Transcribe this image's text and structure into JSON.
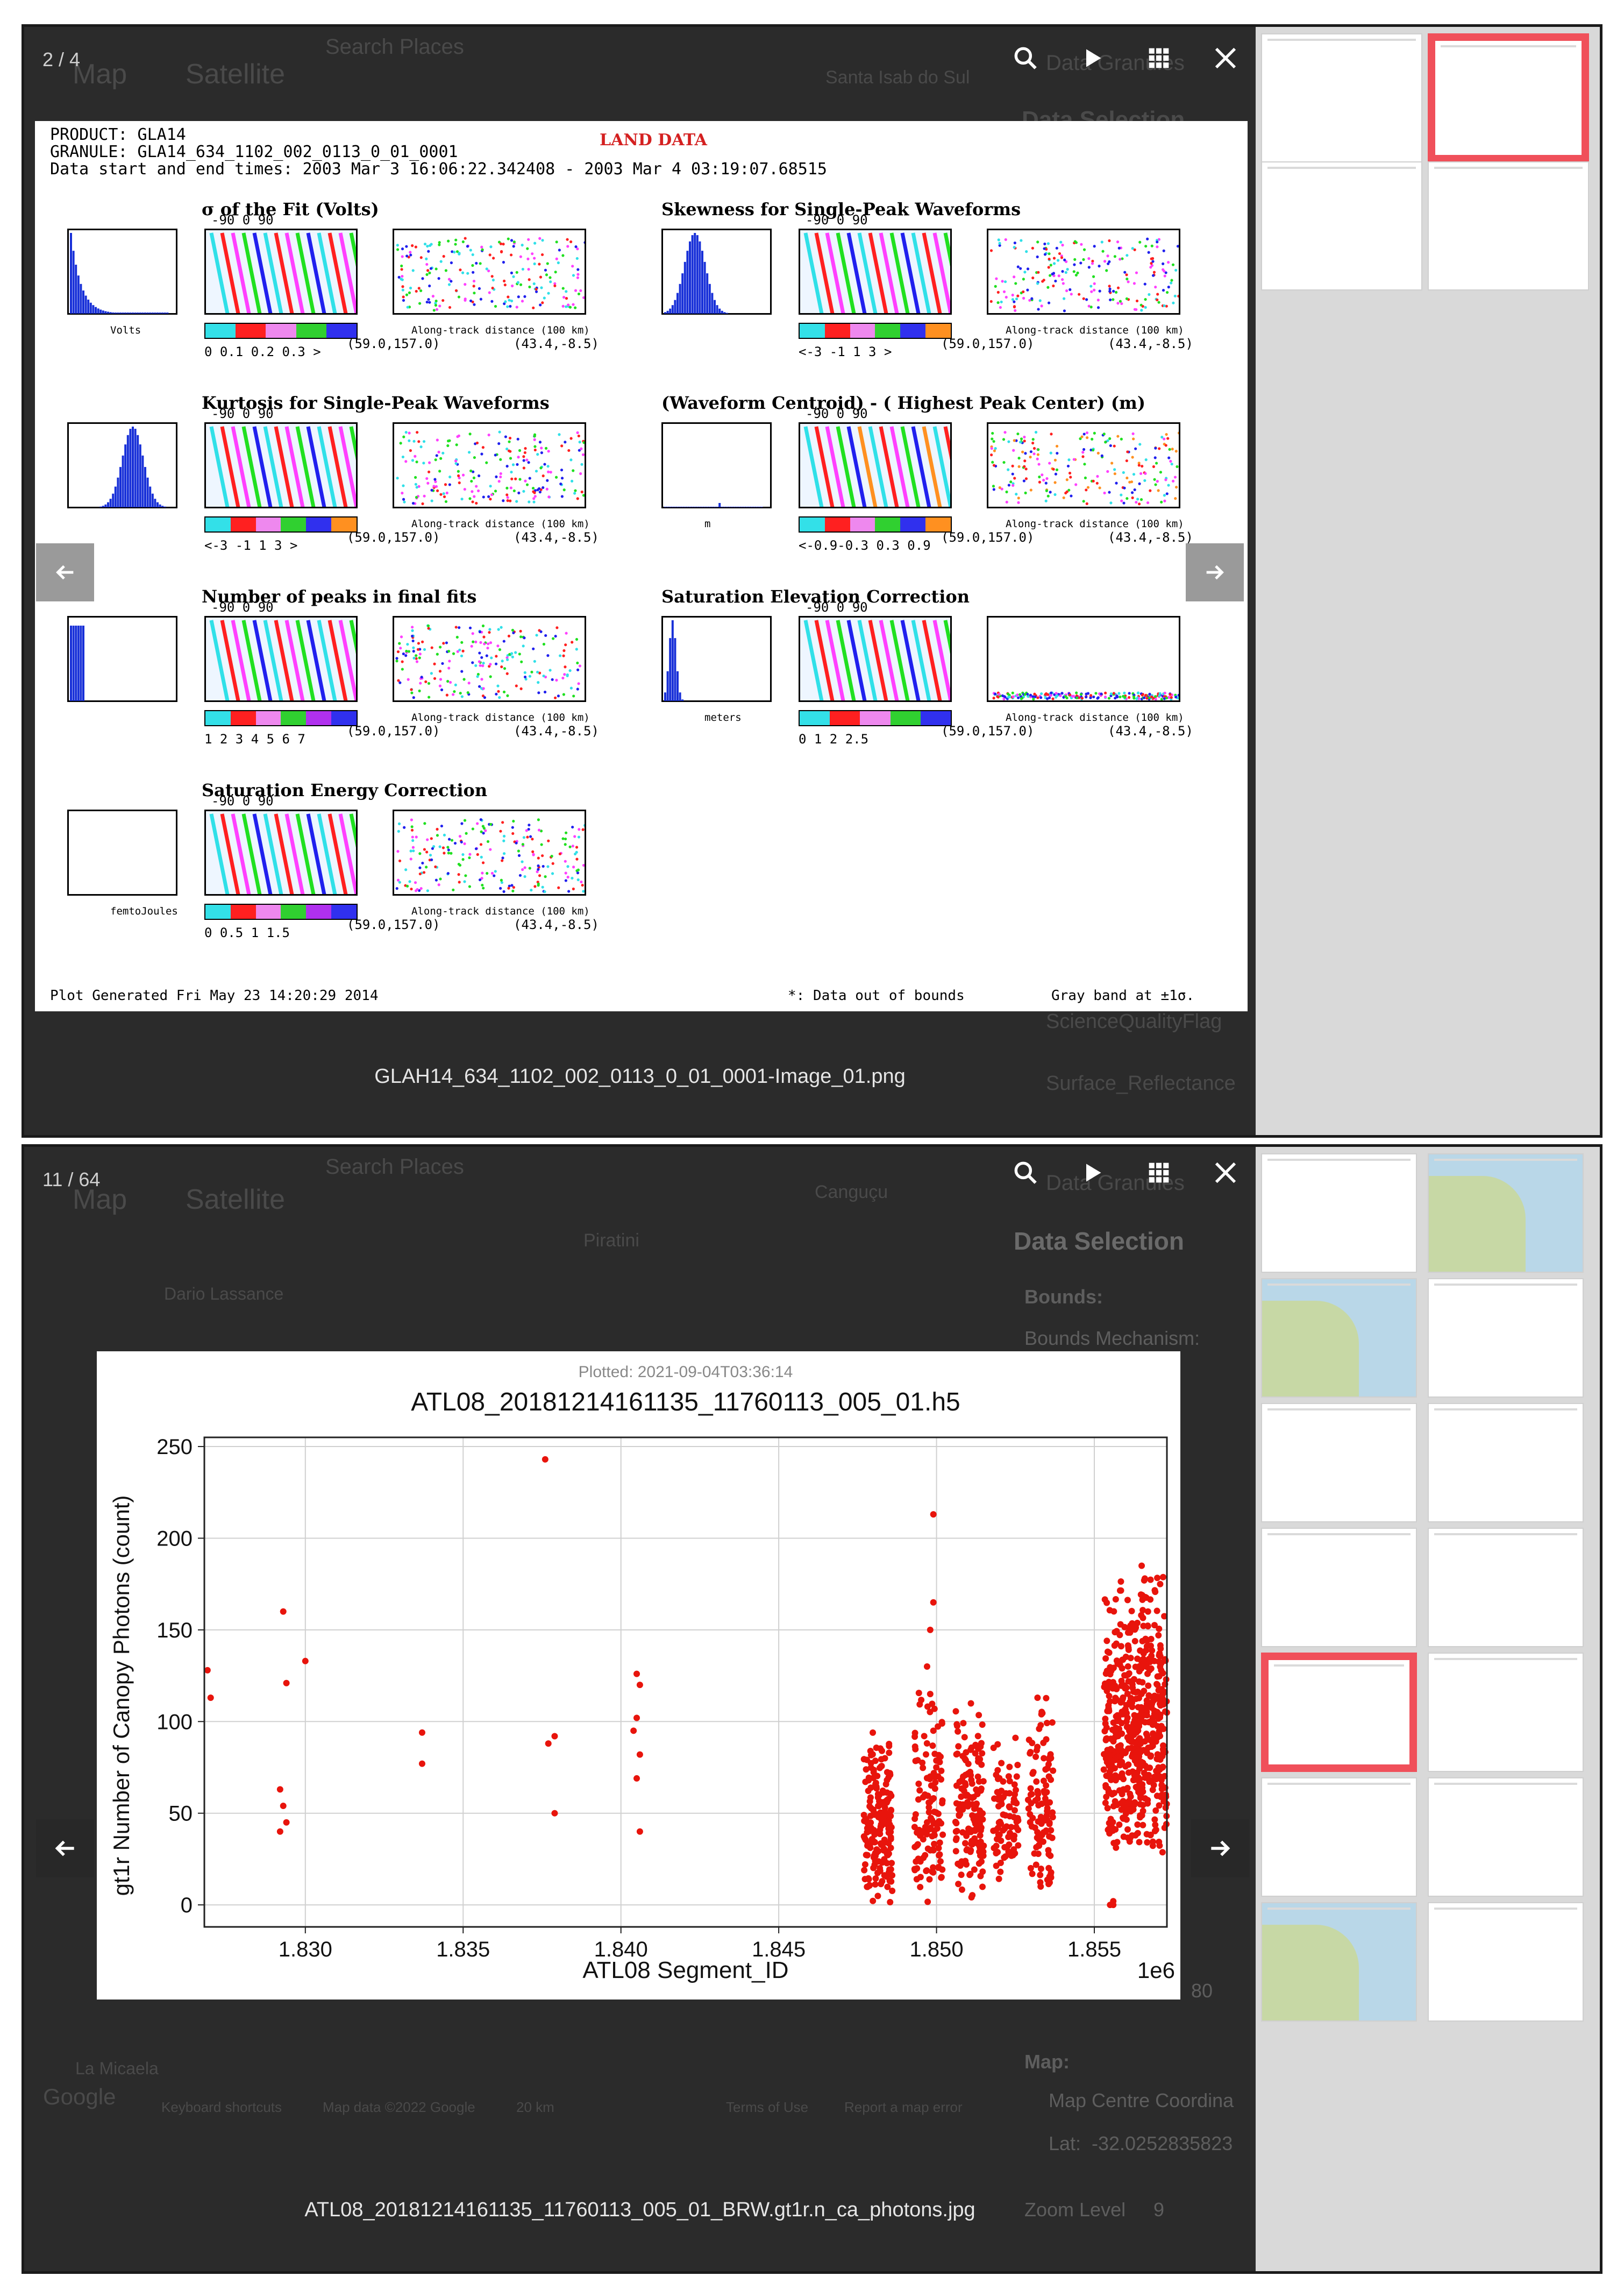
{
  "panel1": {
    "counter": "2 / 4",
    "map_tabs": [
      "Map",
      "Satellite"
    ],
    "search_placeholder": "Search Places",
    "caption": "GLAH14_634_1102_002_0113_0_01_0001-Image_01.png",
    "image": {
      "product": "PRODUCT: GLA14",
      "granule": "GRANULE: GLA14_634_1102_002_0113_0_01_0001",
      "dates": "Data start and end times: 2003 Mar 3 16:06:22.342408 - 2003 Mar 4 03:19:07.68515",
      "land_data": "LAND DATA",
      "titles": [
        "σ of the Fit (Volts)",
        "Skewness for Single-Peak Waveforms",
        "Kurtosis for Single-Peak Waveforms",
        "(Waveform Centroid) - ( Highest Peak Center) (m)",
        "Number of peaks in final fits",
        "Saturation Elevation Correction",
        "Saturation Energy Correction"
      ],
      "map_ticks": "-90 0 90",
      "along_track": "Along-track distance (100 km)",
      "coord_start": "(59.0,157.0)",
      "coord_end": "(43.4,-8.5)",
      "cbar_labels": [
        "0  0.1  0.2  0.3  >",
        "<-3   -1    1    3 >",
        "<-3   -1    1    3 >",
        "<-0.9-0.3 0.3 0.9",
        "1  2  3  4  5  6  7",
        "0       1       2  2.5",
        "0   0.5   1   1.5"
      ],
      "hist_xlabels": [
        "Volts",
        "",
        "",
        "m",
        "",
        "meters",
        "femtoJoules"
      ],
      "footer_left": "Plot Generated Fri May 23 14:20:29 2014",
      "footer_mid": "*: Data out of bounds",
      "footer_right": "Gray band at ±1σ."
    },
    "bg_labels": [
      "Data Granules",
      "Data Selection",
      "ScienceQualityFlag",
      "Surface_Reflectance",
      "Santa Isab do Sul"
    ]
  },
  "panel2": {
    "counter": "11 / 64",
    "map_tabs": [
      "Map",
      "Satellite"
    ],
    "search_placeholder": "Search Places",
    "caption": "ATL08_20181214161135_11760113_005_01_BRW.gt1r.n_ca_photons.jpg",
    "bg_labels": [
      "Data Granules",
      "Data Selection",
      "Bounds:",
      "Bounds Mechanism:",
      "Map:",
      "Map Centre Coordina",
      "Lat:",
      "-32.0252835823",
      "Zoom Level",
      "9",
      "Keyboard shortcuts",
      "Map data ©2022 Google",
      "20 km",
      "Terms of Use",
      "Report a map error",
      "Google",
      "Piratini",
      "Canguçu",
      "La Micaela",
      "Dario Lassance",
      "80"
    ]
  },
  "chart_data": {
    "type": "scatter",
    "subtitle": "Plotted: 2021-09-04T03:36:14",
    "title": "ATL08_20181214161135_11760113_005_01.h5",
    "xlabel": "ATL08 Segment_ID",
    "ylabel": "gt1r Number of Canopy Photons (count)",
    "x_offset_label": "1e6",
    "xlim": [
      1826800,
      1857300
    ],
    "ylim": [
      -12,
      255
    ],
    "xticks": [
      1.83,
      1.835,
      1.84,
      1.845,
      1.85,
      1.855
    ],
    "xtick_labels": [
      "1.830",
      "1.835",
      "1.840",
      "1.845",
      "1.850",
      "1.855"
    ],
    "yticks": [
      0,
      50,
      100,
      150,
      200,
      250
    ],
    "grid": true,
    "color": "#e8140c",
    "x": [
      1826900,
      1827000,
      1829300,
      1829400,
      1829200,
      1829300,
      1829400,
      1829200,
      1830000,
      1833700,
      1833700,
      1837600,
      1837900,
      1837700,
      1837900,
      1840500,
      1840600,
      1840500,
      1840400,
      1840600,
      1840500,
      1840600,
      1849900,
      1849900,
      1849800,
      1849700,
      1849800,
      1849900,
      1849800,
      1849700,
      1853200,
      1853300,
      1853400,
      1853200,
      1853300,
      1853100,
      1853300,
      1855500,
      1855600,
      1855600,
      1856500,
      1856600,
      1856700,
      1856700,
      1856800,
      1856900,
      1857000,
      1856200,
      1856300,
      1856400
    ],
    "y": [
      128,
      113,
      160,
      121,
      63,
      54,
      45,
      40,
      133,
      94,
      77,
      243,
      92,
      88,
      50,
      126,
      120,
      102,
      95,
      82,
      69,
      40,
      213,
      165,
      150,
      130,
      115,
      95,
      70,
      45,
      113,
      98,
      80,
      62,
      45,
      28,
      10,
      0,
      2,
      0,
      185,
      178,
      160,
      152,
      145,
      133,
      120,
      108,
      100,
      90
    ],
    "clusters": [
      {
        "x_range": [
          1847700,
          1848600
        ],
        "y_range": [
          0,
          95
        ],
        "n": 190
      },
      {
        "x_range": [
          1849300,
          1850200
        ],
        "y_range": [
          0,
          120
        ],
        "n": 120
      },
      {
        "x_range": [
          1850600,
          1851500
        ],
        "y_range": [
          0,
          115
        ],
        "n": 150
      },
      {
        "x_range": [
          1851800,
          1852600
        ],
        "y_range": [
          10,
          95
        ],
        "n": 90
      },
      {
        "x_range": [
          1852900,
          1853700
        ],
        "y_range": [
          0,
          115
        ],
        "n": 100
      },
      {
        "x_range": [
          1855300,
          1857300
        ],
        "y_range": [
          25,
          185
        ],
        "n": 560
      }
    ]
  }
}
